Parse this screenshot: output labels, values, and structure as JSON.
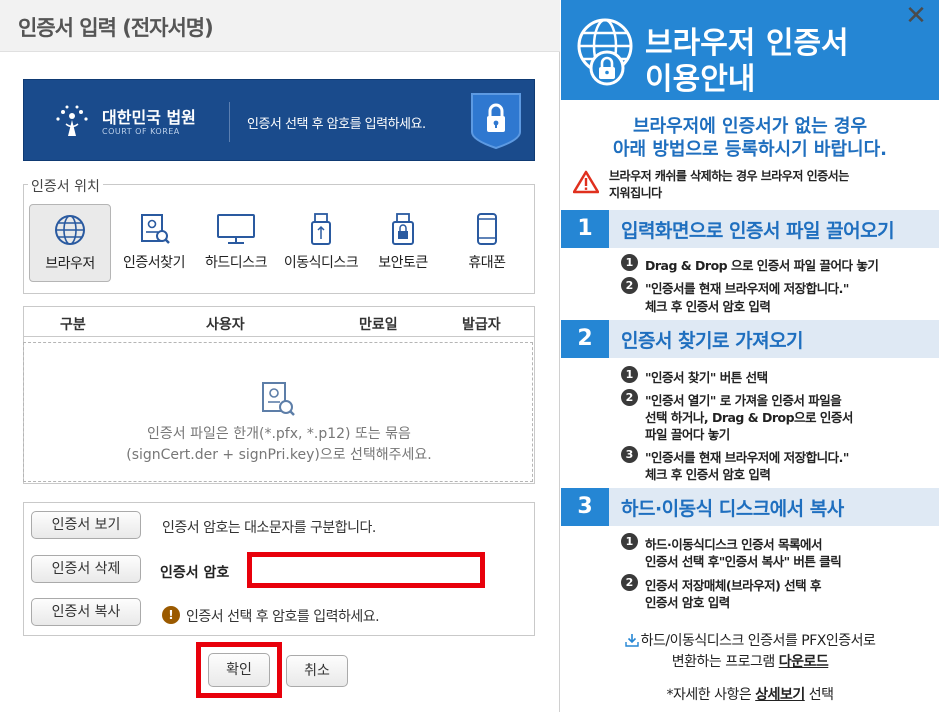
{
  "dialog": {
    "title": "인증서 입력 (전자서명)",
    "banner": {
      "court_name": "대한민국 법원",
      "court_name_en": "COURT OF KOREA",
      "message": "인증서 선택 후 암호를 입력하세요."
    },
    "location": {
      "legend": "인증서 위치",
      "items": [
        {
          "label": "브라우저",
          "icon": "globe-icon"
        },
        {
          "label": "인증서찾기",
          "icon": "certificate-search-icon"
        },
        {
          "label": "하드디스크",
          "icon": "monitor-icon"
        },
        {
          "label": "이동식디스크",
          "icon": "usb-icon"
        },
        {
          "label": "보안토큰",
          "icon": "security-token-icon"
        },
        {
          "label": "휴대폰",
          "icon": "phone-icon"
        }
      ]
    },
    "table": {
      "columns": [
        "구분",
        "사용자",
        "만료일",
        "발급자"
      ],
      "empty_line1": "인증서 파일은 한개(*.pfx, *.p12) 또는 묶음",
      "empty_line2": "(signCert.der + signPri.key)으로 선택해주세요."
    },
    "controls": {
      "view_button": "인증서 보기",
      "delete_button": "인증서 삭제",
      "copy_button": "인증서 복사",
      "case_note": "인증서 암호는 대소문자를 구분합니다.",
      "password_label": "인증서 암호",
      "password_value": "",
      "hint": "인증서 선택 후 암호를 입력하세요."
    },
    "footer": {
      "ok": "확인",
      "cancel": "취소"
    }
  },
  "guide": {
    "title_line1": "브라우저 인증서",
    "title_line2": "이용안내",
    "sub_line1": "브라우저에 인증서가 없는 경우",
    "sub_line2": "아래 방법으로 등록하시기 바랍니다.",
    "warning_line1": "브라우저 캐쉬를 삭제하는 경우 브라우저 인증서는",
    "warning_line2": "지워집니다",
    "steps": [
      {
        "num": "1",
        "title": "입력화면으로 인증서 파일 끌어오기",
        "items": [
          {
            "n": "1",
            "lines": [
              "Drag & Drop 으로 인증서 파일 끌어다 놓기"
            ]
          },
          {
            "n": "2",
            "lines": [
              "\"인증서를 현재 브라우저에 저장합니다.\"",
              "체크 후 인증서 암호 입력"
            ]
          }
        ]
      },
      {
        "num": "2",
        "title": "인증서 찾기로 가져오기",
        "items": [
          {
            "n": "1",
            "lines": [
              "\"인증서 찾기\" 버튼 선택"
            ]
          },
          {
            "n": "2",
            "lines": [
              "\"인증서 열기\" 로 가져올 인증서 파일을",
              "선택 하거나, Drag & Drop으로 인증서",
              "파일 끌어다 놓기"
            ]
          },
          {
            "n": "3",
            "lines": [
              "\"인증서를 현재 브라우저에 저장합니다.\"",
              "체크 후 인증서 암호 입력"
            ]
          }
        ]
      },
      {
        "num": "3",
        "title": "하드·이동식 디스크에서 복사",
        "items": [
          {
            "n": "1",
            "lines": [
              "하드·이동식디스크 인증서 목록에서",
              "인증서 선택 후\"인증서 복사\" 버튼 클릭"
            ]
          },
          {
            "n": "2",
            "lines": [
              "인증서 저장매체(브라우저) 선택 후",
              "인증서 암호 입력"
            ]
          }
        ]
      }
    ],
    "download_line1": "하드/이동식디스크 인증서를 PFX인증서로",
    "download_line2_prefix": "변환하는 프로그램 ",
    "download_link": "다운로드",
    "detail_prefix": "*자세한 사항은 ",
    "detail_link": "상세보기",
    "detail_suffix": " 선택",
    "close": "✕"
  },
  "colors": {
    "banner_blue": "#1a4b8c",
    "guide_blue": "#2586d4",
    "highlight_red": "#e8000b"
  }
}
